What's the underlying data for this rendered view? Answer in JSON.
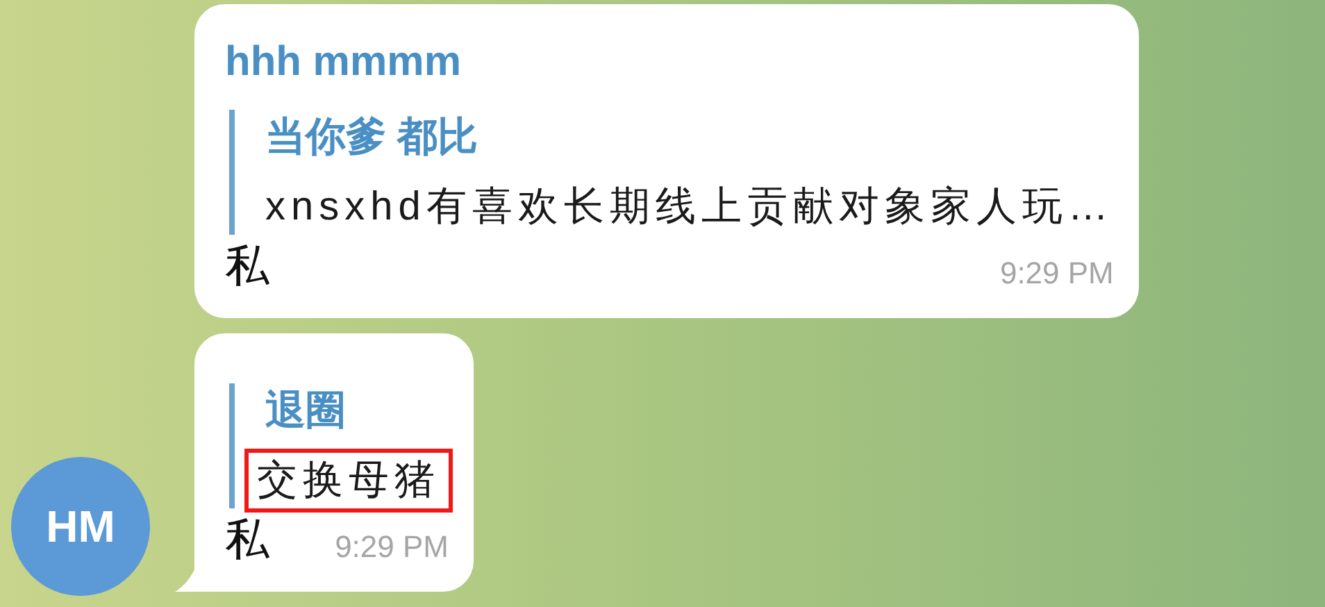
{
  "messages": [
    {
      "sender": "hhh mmmm",
      "reply": {
        "author": "当你爹 都比",
        "text": "xnsxhd有喜欢长期线上贡献对象家人玩…",
        "highlighted": false
      },
      "text": "私",
      "time": "9:29 PM",
      "tail": false
    },
    {
      "reply": {
        "author": "退圈",
        "text": "交换母猪",
        "highlighted": true
      },
      "text": "私",
      "time": "9:29 PM",
      "tail": true,
      "avatar": "HM"
    }
  ]
}
